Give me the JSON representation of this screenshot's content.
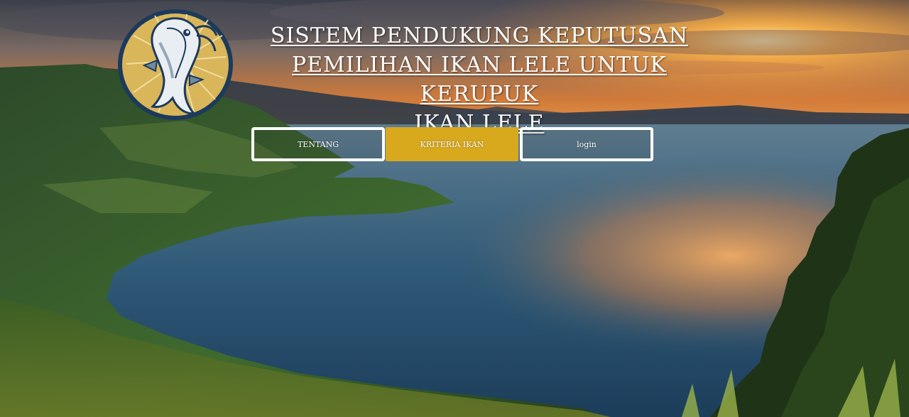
{
  "header": {
    "logo_icon": "catfish-logo-icon",
    "title_lines": [
      "SISTEM PENDUKUNG KEPUTUSAN",
      "PEMILIHAN IKAN LELE UNTUK KERUPUK",
      "IKAN LELE"
    ]
  },
  "nav": {
    "items": [
      {
        "label": "TENTANG",
        "state": "outline"
      },
      {
        "label": "KRITERIA IKAN",
        "state": "active"
      },
      {
        "label": "login",
        "state": "outline"
      }
    ]
  },
  "colors": {
    "accent": "#d8a91d",
    "logo_ring": "#1c3a5c",
    "logo_fill": "#d9b65a",
    "text": "#ffffff"
  }
}
